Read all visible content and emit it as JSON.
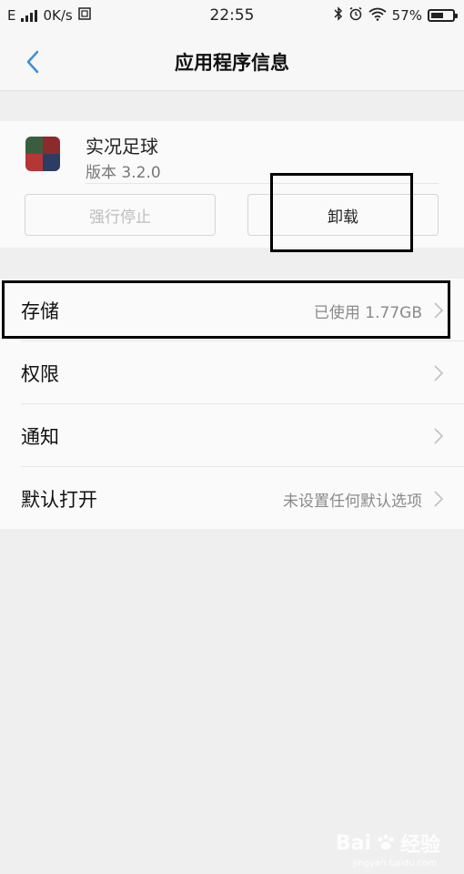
{
  "status_bar": {
    "network_type": "E",
    "speed": "0K/s",
    "time": "22:55",
    "battery": "57%",
    "battery_level": 0.57
  },
  "title_bar": {
    "title": "应用程序信息"
  },
  "app": {
    "name": "实况足球",
    "version": "版本 3.2.0",
    "force_stop_label": "强行停止",
    "uninstall_label": "卸载"
  },
  "settings": {
    "items": [
      {
        "label": "存储",
        "value": "已使用 1.77GB"
      },
      {
        "label": "权限",
        "value": ""
      },
      {
        "label": "通知",
        "value": ""
      },
      {
        "label": "默认打开",
        "value": "未设置任何默认选项"
      }
    ]
  },
  "watermark": {
    "brand": "Bai",
    "brand_suffix": "经验",
    "url": "jingyan.baidu.com"
  },
  "colors": {
    "accent": "#3a8fd8",
    "highlight_border": "#000000"
  }
}
